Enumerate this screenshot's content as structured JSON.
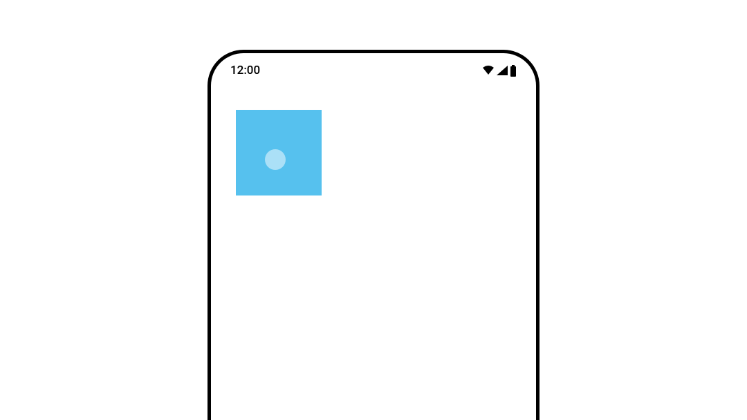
{
  "status_bar": {
    "time": "12:00"
  },
  "colors": {
    "square": "#56C1EE",
    "frame_border": "#000000",
    "touch_indicator": "rgba(255,255,255,0.5)"
  }
}
